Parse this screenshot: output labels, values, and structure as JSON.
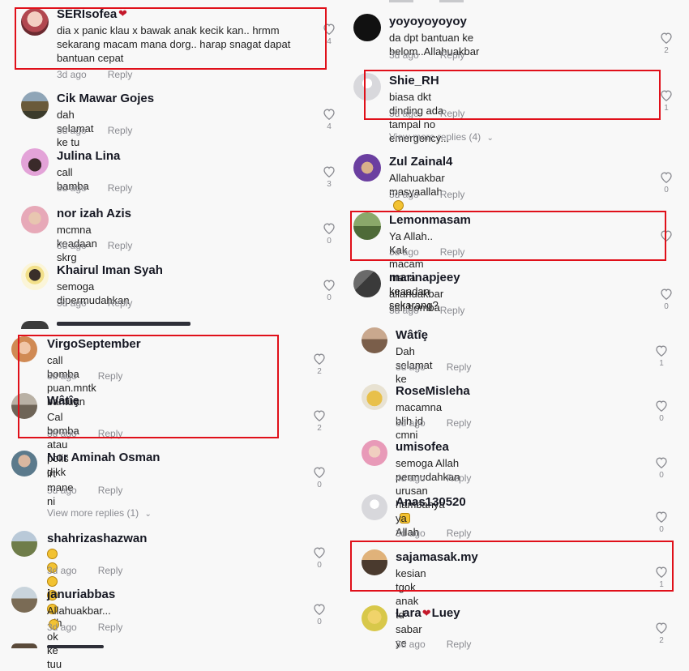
{
  "colors": {
    "highlight": "#e0101a",
    "meta": "#8a8b91",
    "background": "#f8f8f8"
  },
  "left_comments": [
    {
      "name": "SERIsofea",
      "text": "dia x panic klau x bawak anak kecik kan.. hrmm sekarang macam mana dorg.. harap snagat dapat bantuan cepat",
      "time": "3d ago",
      "reply": "Reply",
      "likes": "4"
    },
    {
      "name": "Cik Mawar Gojes",
      "text": "dah selamat ke tu",
      "time": "3d ago",
      "reply": "Reply",
      "likes": "4"
    },
    {
      "name": "Julina Lina",
      "text": "call bamba",
      "time": "3d ago",
      "reply": "Reply",
      "likes": "3"
    },
    {
      "name": "nor izah Azis",
      "text": "mcmna keadaan skrg",
      "time": "3d ago",
      "reply": "Reply",
      "likes": "0"
    },
    {
      "name": "Khairul Iman Syah",
      "text": "semoga dipermudahkan",
      "time": "3d ago",
      "reply": "Reply",
      "likes": "0"
    },
    {
      "name": "VirgoSeptember",
      "text": "call bomba puan.mntk bantuan",
      "time": "3d ago",
      "reply": "Reply",
      "likes": "2"
    },
    {
      "name": "Wâtîȩ",
      "text": "Cal bomba atau polis dikk",
      "time": "3d ago",
      "reply": "Reply",
      "likes": "2"
    },
    {
      "name": "Nor Aminah Osman",
      "text": "lrt mane ni",
      "time": "3d ago",
      "reply": "Reply",
      "likes": "0"
    },
    {
      "name": "shahrizashazwan",
      "text": "dh ok ke tuu",
      "time": "3d ago",
      "reply": "Reply",
      "likes": "0"
    },
    {
      "name": "januriabbas",
      "text": "Allahuakbar...",
      "time": "3d ago",
      "reply": "Reply",
      "likes": "0"
    }
  ],
  "left_view_more": "View more replies (1)",
  "right_comments": [
    {
      "name": "yoyoyoyoyoy",
      "text": "da dpt bantuan ke belom..Allahuakbar",
      "time": "3d ago",
      "reply": "Reply",
      "likes": "2"
    },
    {
      "name": "Shie_RH",
      "text": "biasa dkt dinding ada tampal no emergency...",
      "time": "3d ago",
      "reply": "Reply",
      "likes": "1"
    },
    {
      "name": "Zul Zainal4",
      "text": "Allahuakbar masyaallah",
      "time": "3d ago",
      "reply": "Reply",
      "likes": "0"
    },
    {
      "name": "Lemonmasam",
      "text": "Ya Allah.. Kak macam mana keaadan sekarang?",
      "time": "3d ago",
      "reply": "Reply",
      "likes": ""
    },
    {
      "name": "marinapjeey",
      "text": "allahuakbar call bomba",
      "time": "3d ago",
      "reply": "Reply",
      "likes": "0"
    },
    {
      "name": "Wâtîȩ",
      "text": "Dah selamat ke",
      "time": "3d ago",
      "reply": "Reply",
      "likes": "1"
    },
    {
      "name": "RoseMisleha",
      "text": "macamna blih jd cmni",
      "time": "3d ago",
      "reply": "Reply",
      "likes": "0"
    },
    {
      "name": "umisofea",
      "text": "semoga Allah permudahkan urusan hambanya",
      "time": "4d ago",
      "reply": "Reply",
      "likes": "0"
    },
    {
      "name": "Anas130520",
      "text": "ya Allah",
      "time": "3d ago",
      "reply": "Reply",
      "likes": "0"
    },
    {
      "name": "sajamasak.my",
      "text": "kesian tgok anak td",
      "time": "3d ago",
      "reply": "Reply",
      "likes": "1"
    },
    {
      "name": "Lara",
      "name2": "Luey",
      "text": "sabar ye",
      "time": "3d ago",
      "reply": "Reply",
      "likes": "2"
    }
  ],
  "right_view_more": "View more replies (4)"
}
